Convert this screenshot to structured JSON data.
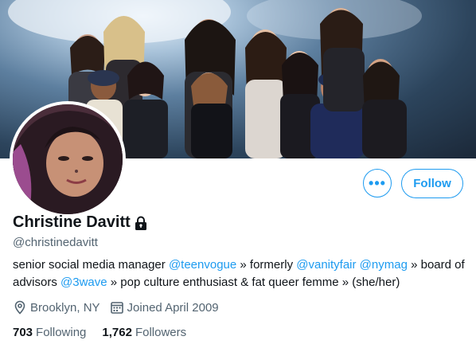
{
  "profile": {
    "name": "Christine Davitt",
    "handle": "@christinedavitt",
    "bio": {
      "t1": "senior social media manager ",
      "m1": "@teenvogue",
      "t2": " » formerly ",
      "m2": "@vanityfair",
      "t3": " ",
      "m3": "@nymag",
      "t4": " » board of advisors ",
      "m4": "@3wave",
      "t5": " » pop culture enthusiast & fat queer femme » (she/her)"
    },
    "location": "Brooklyn, NY",
    "joined": "Joined April 2009",
    "following_count": "703",
    "following_label": "Following",
    "followers_count": "1,762",
    "followers_label": "Followers"
  },
  "actions": {
    "more_label": "•••",
    "follow_label": "Follow"
  },
  "icons": {
    "lock": "lock-icon",
    "location": "location-pin-icon",
    "calendar": "calendar-icon"
  },
  "colors": {
    "accent": "#1d9bf0",
    "secondary_text": "#536471",
    "primary_text": "#0f1419"
  }
}
